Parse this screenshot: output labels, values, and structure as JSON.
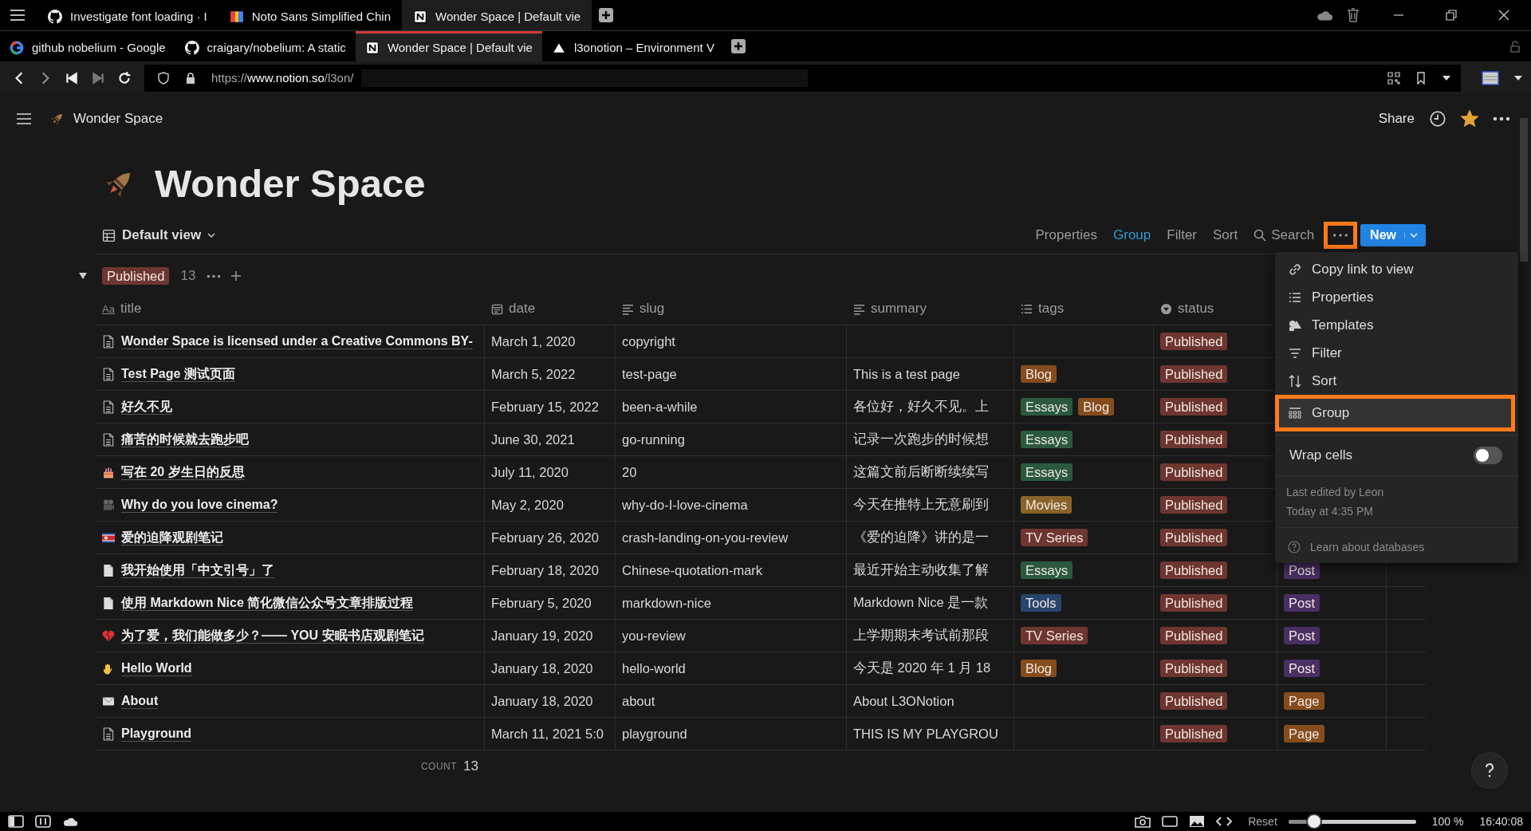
{
  "browser": {
    "tab_rows": [
      [
        {
          "title": "Investigate font loading · I",
          "kind": "octocat",
          "selected": false
        },
        {
          "title": "Noto Sans Simplified Chin",
          "kind": "letters",
          "selected": false
        },
        {
          "title": "Wonder Space | Default vie",
          "kind": "notion",
          "selected": true
        }
      ],
      [
        {
          "title": "github nobelium - Google",
          "kind": "google",
          "selected": false
        },
        {
          "title": "craigary/nobelium: A static",
          "kind": "octocat",
          "selected": false
        },
        {
          "title": "Wonder Space | Default vie",
          "kind": "notion",
          "selected": true
        },
        {
          "title": "l3onotion – Environment V",
          "kind": "triangle",
          "selected": false
        }
      ]
    ],
    "url": {
      "scheme": "https://",
      "domain": "www.notion.so",
      "path": "/l3on/"
    }
  },
  "topbar": {
    "breadcrumb": "Wonder Space",
    "share": "Share",
    "favorite": true
  },
  "page": {
    "title": "Wonder Space"
  },
  "view": {
    "name": "Default view"
  },
  "toolbar": {
    "buttons": [
      {
        "label": "Properties",
        "selected": false
      },
      {
        "label": "Group",
        "selected": true
      },
      {
        "label": "Filter",
        "selected": false
      },
      {
        "label": "Sort",
        "selected": false
      }
    ],
    "search": "Search",
    "more_highlighted": true,
    "new": "New"
  },
  "group": {
    "label": "Published",
    "color": "#6e3630",
    "count": "13",
    "expanded": true
  },
  "columns": [
    {
      "name": "title",
      "kind": "title",
      "prefix": "Aa"
    },
    {
      "name": "date",
      "kind": "date"
    },
    {
      "name": "slug",
      "kind": "text"
    },
    {
      "name": "summary",
      "kind": "text"
    },
    {
      "name": "tags",
      "kind": "multi"
    },
    {
      "name": "status",
      "kind": "select"
    }
  ],
  "rows": [
    {
      "kind": "doc",
      "title": "Wonder Space is licensed under a Creative Commons BY-",
      "date": "March 1, 2020",
      "slug": "copyright",
      "tags": [],
      "status": {
        "label": "Published",
        "color": "#6e3630"
      }
    },
    {
      "kind": "doc",
      "title": "Test Page 测试页面",
      "date": "March 5, 2022",
      "slug": "test-page",
      "summary": "This is a test page",
      "tags": [
        {
          "label": "Blog",
          "color": "#854c1d"
        }
      ],
      "status": {
        "label": "Published",
        "color": "#6e3630"
      }
    },
    {
      "kind": "doc",
      "title": "好久不见",
      "date": "February 15, 2022",
      "slug": "been-a-while",
      "summary": "各位好，好久不见。上",
      "tags": [
        {
          "label": "Essays",
          "color": "#2b593f"
        },
        {
          "label": "Blog",
          "color": "#854c1d"
        }
      ],
      "status": {
        "label": "Published",
        "color": "#6e3630"
      }
    },
    {
      "kind": "doc",
      "title": "痛苦的时候就去跑步吧",
      "date": "June 30, 2021",
      "slug": "go-running",
      "summary": "记录一次跑步的时候想",
      "tags": [
        {
          "label": "Essays",
          "color": "#2b593f"
        }
      ],
      "status": {
        "label": "Published",
        "color": "#6e3630"
      }
    },
    {
      "kind": "cake",
      "title": "写在 20 岁生日的反思",
      "date": "July 11, 2020",
      "slug": "20",
      "summary": "这篇文前后断断续续写",
      "tags": [
        {
          "label": "Essays",
          "color": "#2b593f"
        }
      ],
      "status": {
        "label": "Published",
        "color": "#6e3630"
      }
    },
    {
      "kind": "camera",
      "title": "Why do you love cinema?",
      "date": "May 2, 2020",
      "slug": "why-do-I-love-cinema",
      "summary": "今天在推特上无意刷到",
      "tags": [
        {
          "label": "Movies",
          "color": "#89632a"
        }
      ],
      "status": {
        "label": "Published",
        "color": "#6e3630"
      }
    },
    {
      "kind": "flag",
      "title": "爱的迫降观剧笔记",
      "date": "February 26, 2020",
      "slug": "crash-landing-on-you-review",
      "summary": "《爱的迫降》讲的是一",
      "tags": [
        {
          "label": "TV Series",
          "color": "#6e3630"
        }
      ],
      "status": {
        "label": "Published",
        "color": "#6e3630"
      }
    },
    {
      "kind": "page",
      "title": "我开始使用「中文引号」了",
      "date": "February 18, 2020",
      "slug": "Chinese-quotation-mark",
      "summary": "最近开始主动收集了解",
      "tags": [
        {
          "label": "Essays",
          "color": "#2b593f"
        }
      ],
      "status": {
        "label": "Published",
        "color": "#6e3630"
      },
      "type": {
        "label": "Post",
        "color": "#492f64"
      }
    },
    {
      "kind": "page",
      "title": "使用 Markdown Nice 简化微信公众号文章排版过程",
      "date": "February 5, 2020",
      "slug": "markdown-nice",
      "summary": "Markdown Nice 是一款",
      "tags": [
        {
          "label": "Tools",
          "color": "#28456c"
        }
      ],
      "status": {
        "label": "Published",
        "color": "#6e3630"
      },
      "type": {
        "label": "Post",
        "color": "#492f64"
      }
    },
    {
      "kind": "heart",
      "title": "为了爱，我们能做多少？—— YOU 安眠书店观剧笔记",
      "date": "January 19, 2020",
      "slug": "you-review",
      "summary": "上学期期末考试前那段",
      "tags": [
        {
          "label": "TV Series",
          "color": "#6e3630"
        }
      ],
      "status": {
        "label": "Published",
        "color": "#6e3630"
      },
      "type": {
        "label": "Post",
        "color": "#492f64"
      }
    },
    {
      "kind": "hand",
      "title": "Hello World",
      "date": "January 18, 2020",
      "slug": "hello-world",
      "summary": "今天是 2020 年 1 月 18",
      "tags": [
        {
          "label": "Blog",
          "color": "#854c1d"
        }
      ],
      "status": {
        "label": "Published",
        "color": "#6e3630"
      },
      "type": {
        "label": "Post",
        "color": "#492f64"
      }
    },
    {
      "kind": "mail",
      "title": "About",
      "date": "January 18, 2020",
      "slug": "about",
      "summary": "About L3ONotion",
      "tags": [],
      "status": {
        "label": "Published",
        "color": "#6e3630"
      },
      "type": {
        "label": "Page",
        "color": "#854c1d"
      }
    },
    {
      "kind": "doc",
      "title": "Playground",
      "date": "March 11, 2021 5:0",
      "slug": "playground",
      "summary": "THIS IS MY PLAYGROU",
      "tags": [],
      "status": {
        "label": "Published",
        "color": "#6e3630"
      },
      "type": {
        "label": "Page",
        "color": "#854c1d"
      }
    }
  ],
  "count": {
    "label": "COUNT",
    "value": "13"
  },
  "menu": {
    "items": [
      {
        "label": "Copy link to view",
        "kind": "link",
        "highlighted": false
      },
      {
        "label": "Properties",
        "kind": "list",
        "highlighted": false
      },
      {
        "label": "Templates",
        "kind": "shapes",
        "highlighted": false
      },
      {
        "label": "Filter",
        "kind": "filter",
        "highlighted": false
      },
      {
        "label": "Sort",
        "kind": "sort",
        "highlighted": false
      },
      {
        "label": "Group",
        "kind": "grid",
        "highlighted": true
      }
    ],
    "wrap_cells": {
      "label": "Wrap cells",
      "on": false
    },
    "edited": [
      "Last edited by Leon",
      "Today at 4:35 PM"
    ],
    "help": "Learn about databases"
  },
  "status_bar": {
    "reset": "Reset",
    "zoom": {
      "level": 0.2
    },
    "zoom_text": "100 %",
    "time": "16:40:08"
  }
}
